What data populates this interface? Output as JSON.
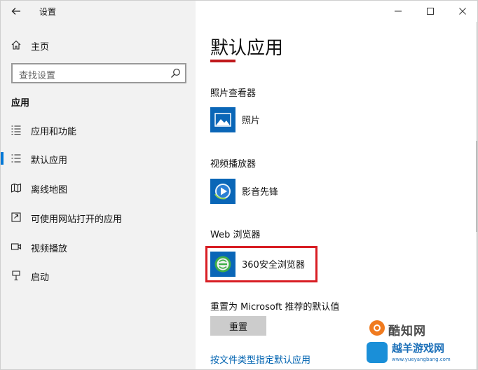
{
  "window": {
    "title": "设置"
  },
  "sidebar": {
    "home_label": "主页",
    "search_placeholder": "查找设置",
    "section_heading": "应用",
    "items": [
      {
        "label": "应用和功能",
        "icon": "apps-features-icon",
        "selected": false
      },
      {
        "label": "默认应用",
        "icon": "default-apps-icon",
        "selected": true
      },
      {
        "label": "离线地图",
        "icon": "offline-maps-icon",
        "selected": false
      },
      {
        "label": "可使用网站打开的应用",
        "icon": "apps-for-websites-icon",
        "selected": false
      },
      {
        "label": "视频播放",
        "icon": "video-playback-icon",
        "selected": false
      },
      {
        "label": "启动",
        "icon": "startup-icon",
        "selected": false
      }
    ]
  },
  "main": {
    "page_title": "默认应用",
    "categories": [
      {
        "heading": "照片查看器",
        "app": "照片",
        "icon": "photos-icon"
      },
      {
        "heading": "视频播放器",
        "app": "影音先锋",
        "icon": "video-player-icon"
      },
      {
        "heading": "Web 浏览器",
        "app": "360安全浏览器",
        "icon": "browser-360-icon"
      }
    ],
    "reset_heading": "重置为 Microsoft 推荐的默认值",
    "reset_button": "重置",
    "file_type_link": "按文件类型指定默认应用"
  },
  "watermark": {
    "brand1": "酷知网",
    "brand2": "越羊游戏网",
    "url": "www.yueyangbang.com"
  },
  "colors": {
    "accent": "#0078d7",
    "title_underline": "#c0191c",
    "highlight_box": "#d81e24",
    "link": "#0063b1"
  }
}
